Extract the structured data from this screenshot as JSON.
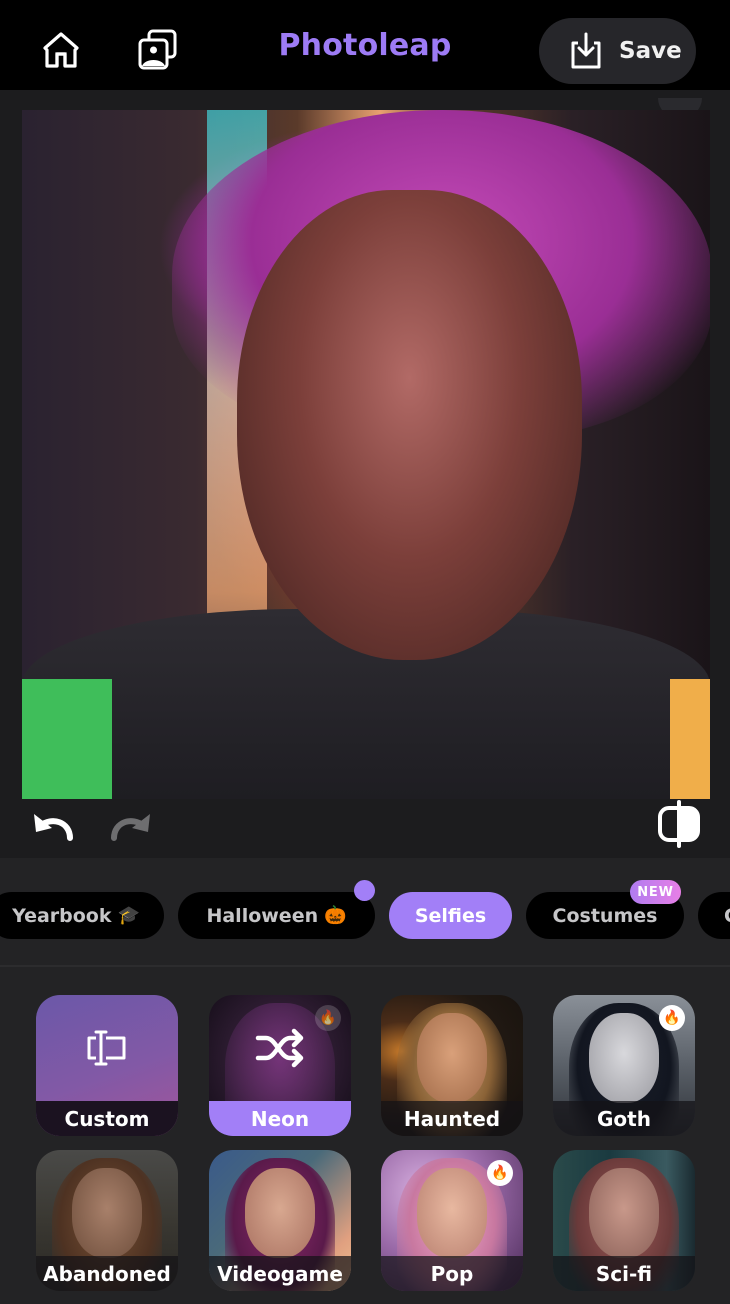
{
  "header": {
    "title": "Photoleap",
    "home_icon": "home-icon",
    "gallery_icon": "gallery-icon",
    "save_label": "Save",
    "save_icon": "download-icon"
  },
  "canvas": {
    "image_description": "AI-stylized portrait of a man with magenta curly hair under neon lighting",
    "undo_icon": "undo-icon",
    "redo_icon": "redo-icon",
    "compare_icon": "compare-icon"
  },
  "categories": [
    {
      "label": "Yearbook",
      "emoji": "🎓",
      "active": false
    },
    {
      "label": "Halloween",
      "emoji": "🎃",
      "active": false,
      "dot": true
    },
    {
      "label": "Selfies",
      "emoji": "",
      "active": true
    },
    {
      "label": "Costumes",
      "emoji": "",
      "active": false,
      "badge": "NEW"
    },
    {
      "label": "C",
      "emoji": "",
      "active": false
    }
  ],
  "styles": [
    {
      "label": "Custom",
      "icon": "custom-text-icon",
      "selected": false
    },
    {
      "label": "Neon",
      "icon": "shuffle-icon",
      "selected": true,
      "hot": true
    },
    {
      "label": "Haunted",
      "selected": false
    },
    {
      "label": "Goth",
      "selected": false,
      "hot": true
    },
    {
      "label": "Abandoned",
      "selected": false
    },
    {
      "label": "Videogame",
      "selected": false
    },
    {
      "label": "Pop",
      "selected": false,
      "hot": true
    },
    {
      "label": "Sci-fi",
      "selected": false
    }
  ],
  "colors": {
    "accent": "#a27ff7",
    "title": "#9d7bf5",
    "background": "#1c1c1e",
    "chip_background": "#000000"
  }
}
